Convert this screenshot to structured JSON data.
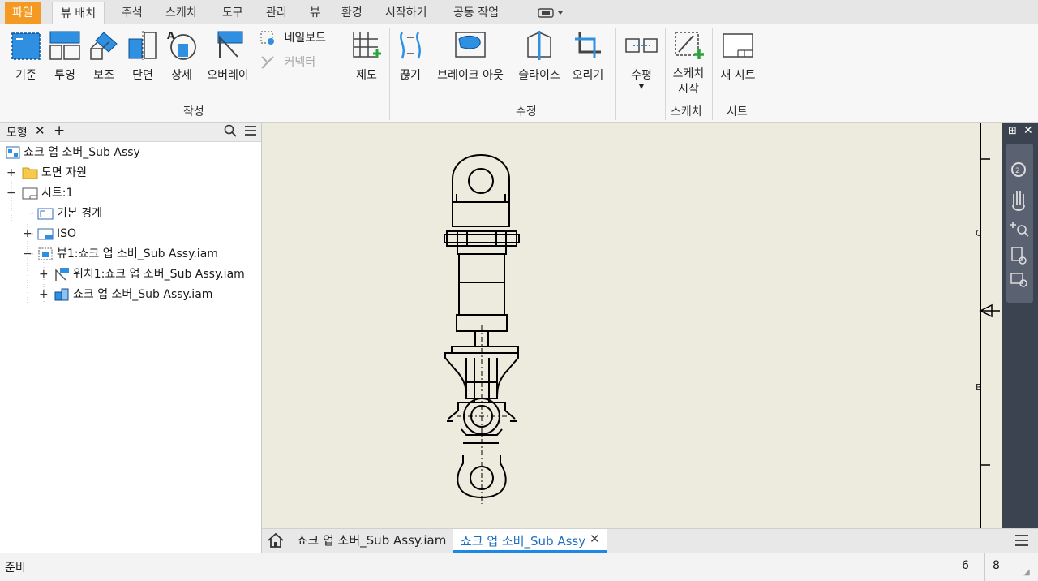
{
  "menubar": {
    "tabs": [
      "파일",
      "뷰 배치",
      "주석",
      "스케치",
      "도구",
      "관리",
      "뷰",
      "환경",
      "시작하기",
      "공동 작업"
    ],
    "active_tab": "뷰 배치"
  },
  "ribbon": {
    "create": {
      "label": "작성",
      "buttons": [
        "기준",
        "투영",
        "보조",
        "단면",
        "상세",
        "오버레이"
      ],
      "nailboard": "네일보드",
      "connector": "커넥터"
    },
    "draft": "제도",
    "modify": {
      "label": "수정",
      "buttons": [
        "끊기",
        "브레이크 아웃",
        "슬라이스",
        "오리기"
      ]
    },
    "horizontal": "수평",
    "sketch": {
      "label": "스케치",
      "button": "스케치\n시작"
    },
    "sheet": {
      "label": "시트",
      "button": "새 시트"
    }
  },
  "browser": {
    "tab_label": "모형",
    "items": [
      "쇼크 업 소버_Sub Assy",
      "도면 자원",
      "시트:1",
      "기본 경계",
      "ISO",
      "뷰1:쇼크 업 소버_Sub Assy.iam",
      "위치1:쇼크 업 소버_Sub Assy.iam",
      "쇼크 업 소버_Sub Assy.iam"
    ]
  },
  "canvas": {
    "zone_labels": [
      "C",
      "B"
    ]
  },
  "doc_tabs": [
    "쇼크 업 소버_Sub Assy.iam",
    "쇼크 업 소버_Sub Assy"
  ],
  "status": {
    "text": "준비",
    "count1": "6",
    "count2": "8"
  },
  "colors": {
    "file_tab": "#f49a22",
    "canvas_bg": "#ecebdd",
    "accent": "#1e88e5",
    "rightbar": "#3c4350"
  }
}
